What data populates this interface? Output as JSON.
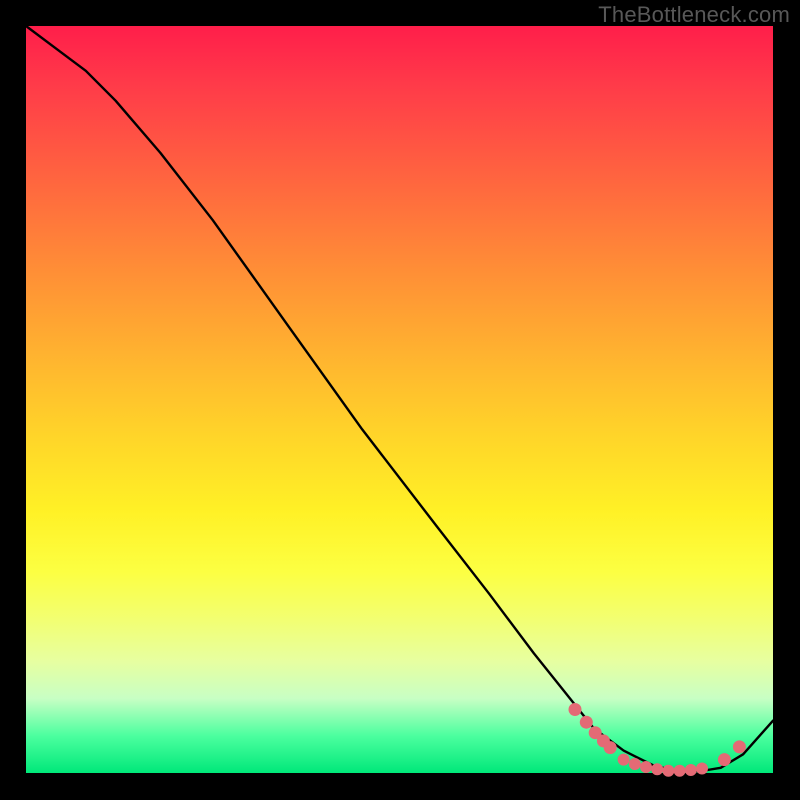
{
  "watermark": "TheBottleneck.com",
  "colors": {
    "dot": "#e46a75",
    "line": "#000000"
  },
  "chart_data": {
    "type": "line",
    "title": "",
    "xlabel": "",
    "ylabel": "",
    "xlim": [
      0,
      100
    ],
    "ylim": [
      0,
      100
    ],
    "series": [
      {
        "name": "curve",
        "x": [
          0,
          4,
          8,
          12,
          18,
          25,
          35,
          45,
          55,
          62,
          68,
          72,
          76,
          80,
          84,
          87,
          90,
          93,
          96,
          100
        ],
        "y": [
          100,
          97,
          94,
          90,
          83,
          74,
          60,
          46,
          33,
          24,
          16,
          11,
          6,
          3,
          1,
          0.3,
          0.2,
          0.7,
          2.5,
          7
        ]
      }
    ],
    "dots": {
      "x_left_cluster": [
        73.5,
        75.0,
        76.2,
        77.3,
        78.2
      ],
      "y_left_cluster": [
        8.5,
        6.8,
        5.4,
        4.3,
        3.4
      ],
      "x_bottom_cluster": [
        80,
        81.5,
        83,
        84.5,
        86,
        87.5,
        89,
        90.5
      ],
      "y_bottom_cluster": [
        1.8,
        1.2,
        0.8,
        0.5,
        0.3,
        0.3,
        0.4,
        0.6
      ],
      "x_right_cluster": [
        93.5,
        95.5
      ],
      "y_right_cluster": [
        1.8,
        3.5
      ]
    }
  }
}
